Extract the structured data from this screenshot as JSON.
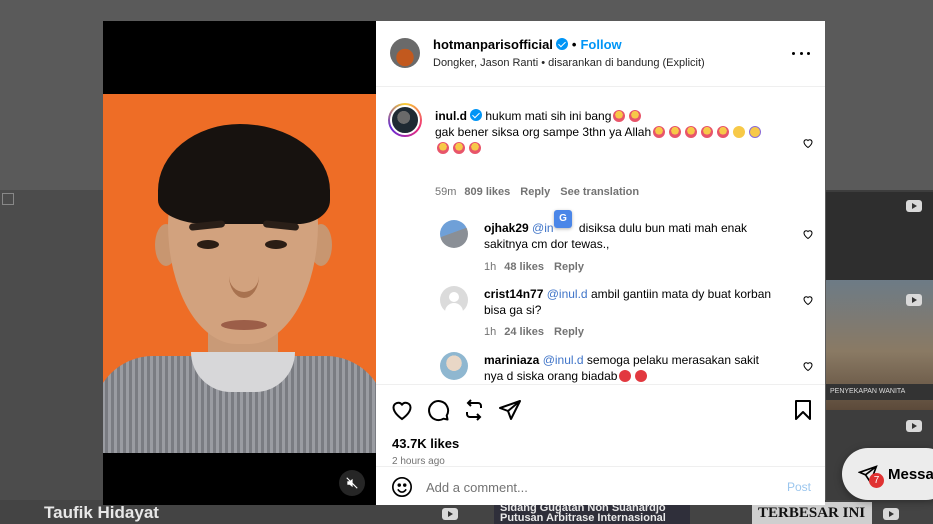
{
  "background": {
    "name_strip": "Taufik Hidayat",
    "news_strip": "Sidang Gugatan Non Suahardjo Putusan Arbitrase Internasional",
    "headline_strip": "TERBESAR INI",
    "right_caption": "PENYEKAPAN WANITA",
    "messages_label": "Messa",
    "messages_badge": "7"
  },
  "post": {
    "username": "hotmanparisofficial",
    "follow_label": "Follow",
    "subtitle": "Dongker, Jason Ranti • disarankan di bandung (Explicit)",
    "likes": "43.7K likes",
    "time": "2 hours ago",
    "comment_placeholder": "Add a comment...",
    "post_label": "Post"
  },
  "comments": [
    {
      "user": "inul.d",
      "text_line1": "hukum mati sih ini bang",
      "text_line2": "gak bener siksa org sampe 3thn ya Allah",
      "age": "59m",
      "likes": "809 likes",
      "reply": "Reply",
      "translate": "See translation"
    },
    {
      "user": "ojhak29",
      "mention": "@in",
      "text_line1": "disiksa dulu bun mati mah enak",
      "text_line2": "sakitnya cm dor tewas.,",
      "age": "1h",
      "likes": "48 likes",
      "reply": "Reply"
    },
    {
      "user": "crist14n77",
      "mention": "@inul.d",
      "text_line1": "ambil gantiin mata dy buat korban",
      "text_line2": "bisa ga si?",
      "age": "1h",
      "likes": "24 likes",
      "reply": "Reply"
    },
    {
      "user": "mariniaza",
      "mention": "@inul.d",
      "text_line1": "semoga pelaku merasakan sakit",
      "text_line2": "nya d siska orang biadab"
    }
  ],
  "icons": [
    "heart-icon",
    "comment-icon",
    "repost-icon",
    "share-icon",
    "bookmark-icon",
    "emoji-icon",
    "mute-icon",
    "more-icon",
    "verified-icon"
  ],
  "colors": {
    "accent": "#0095f6",
    "mention": "#3f74c8",
    "photo_bg": "#ee6d26"
  }
}
